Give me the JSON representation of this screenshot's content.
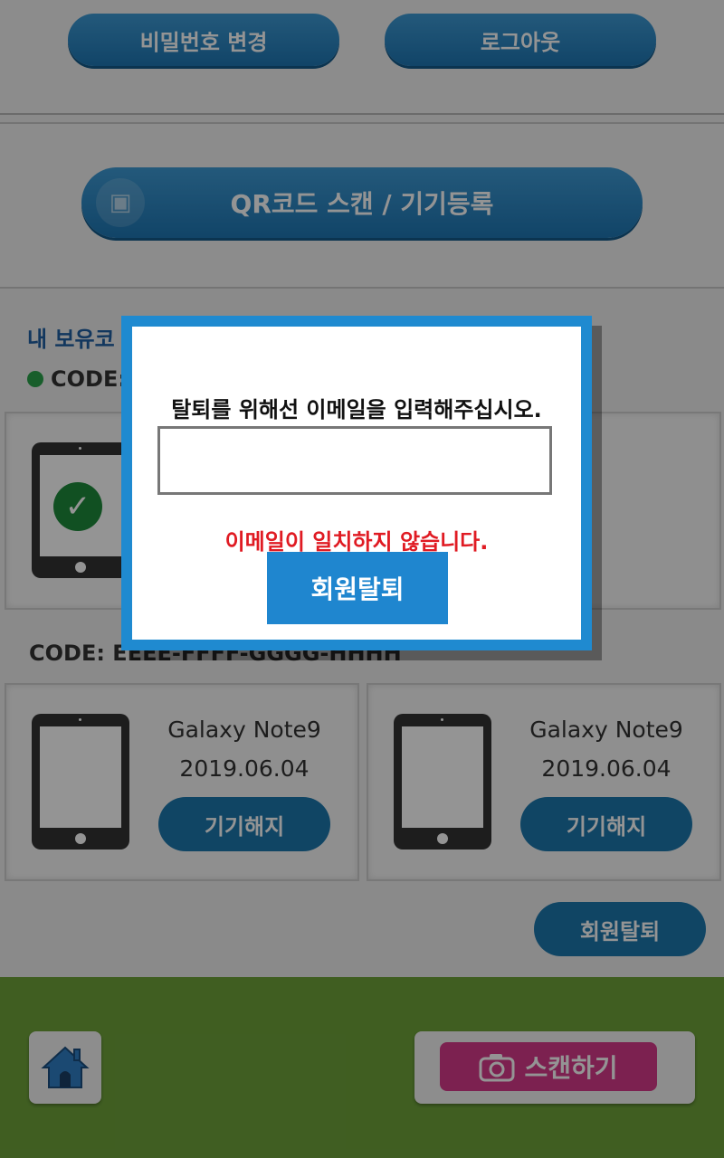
{
  "header": {
    "change_password_label": "비밀번호 변경",
    "logout_label": "로그아웃"
  },
  "qr": {
    "scan_label": "QR코드 스캔 / 기기등록"
  },
  "my_codes": {
    "title": "내 보유코",
    "active_code_label": "CODE:",
    "second_code_label": "CODE: EEEE-FFFF-GGGG-HHHH"
  },
  "devices": [
    {
      "name": "Galaxy Note9",
      "date": "2019.06.04",
      "action": "기기해지"
    },
    {
      "name": "Galaxy Note9",
      "date": "2019.06.04",
      "action": "기기해지"
    }
  ],
  "withdraw_label": "회원탈퇴",
  "bottom": {
    "scan_label": "스캔하기"
  },
  "modal": {
    "title": "탈퇴를 위해선 이메일을 입력해주십시오.",
    "email_value": "",
    "error": "이메일이 일치하지 않습니다.",
    "confirm_label": "회원탈퇴"
  },
  "colors": {
    "primary": "#1f86cf",
    "error": "#e01b23",
    "bottom_bar": "#6ea23a",
    "scan_tag": "#d6398a"
  }
}
